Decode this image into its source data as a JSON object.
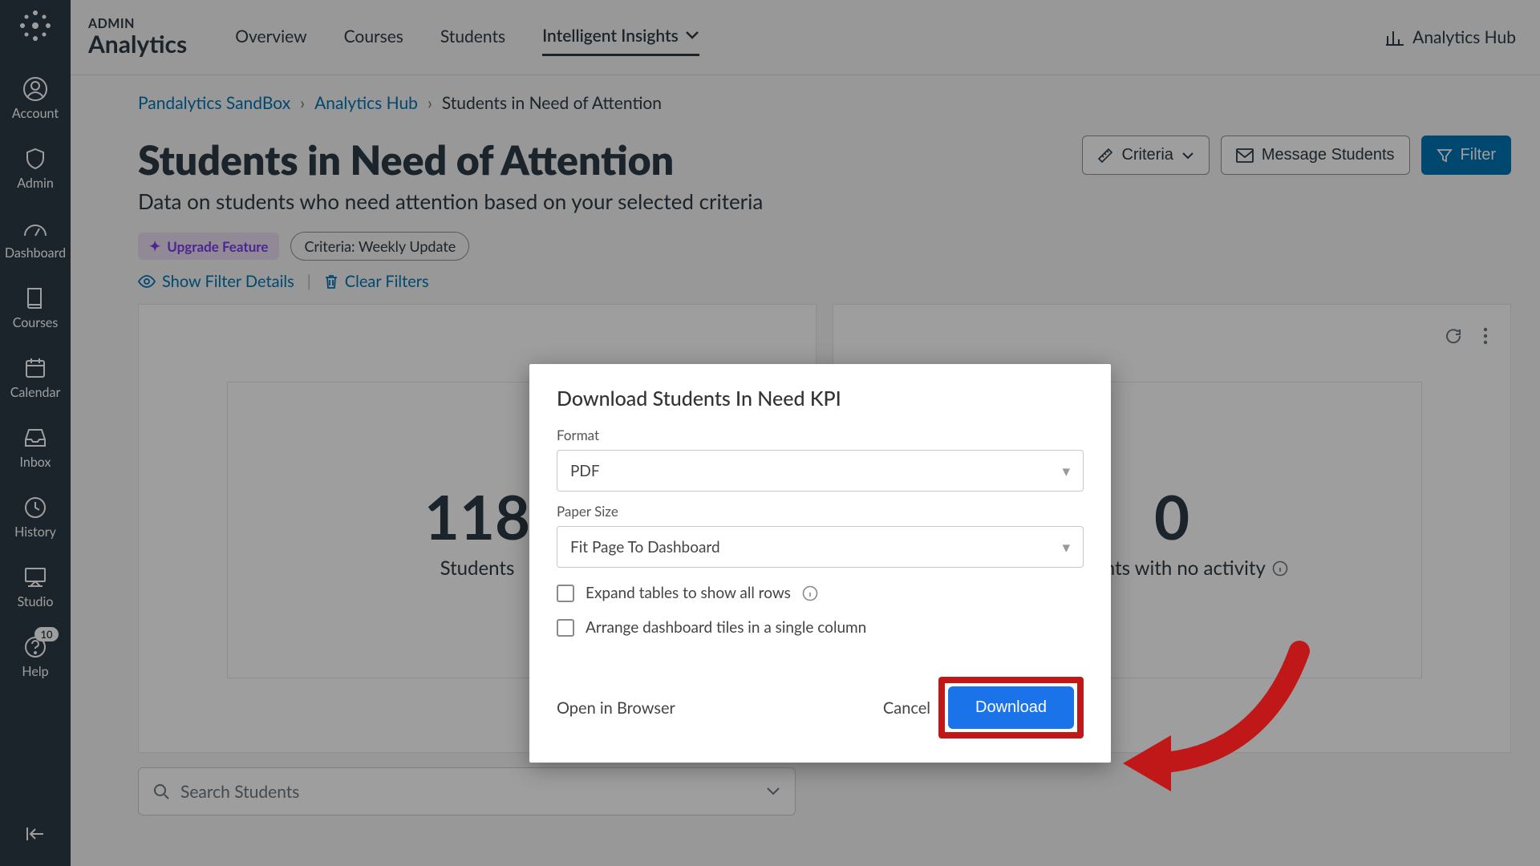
{
  "leftnav": {
    "items": [
      {
        "label": "Account"
      },
      {
        "label": "Admin"
      },
      {
        "label": "Dashboard"
      },
      {
        "label": "Courses"
      },
      {
        "label": "Calendar"
      },
      {
        "label": "Inbox"
      },
      {
        "label": "History"
      },
      {
        "label": "Studio"
      },
      {
        "label": "Help",
        "badge": "10"
      }
    ]
  },
  "topbar": {
    "sup": "ADMIN",
    "title": "Analytics",
    "tabs": [
      {
        "label": "Overview"
      },
      {
        "label": "Courses"
      },
      {
        "label": "Students"
      },
      {
        "label": "Intelligent Insights"
      }
    ],
    "hub": "Analytics Hub"
  },
  "crumbs": {
    "a": "Pandalytics SandBox",
    "b": "Analytics Hub",
    "c": "Students in Need of Attention"
  },
  "page": {
    "title": "Students in Need of Attention",
    "subtitle": "Data on students who need attention based on your selected criteria",
    "upgrade": "Upgrade Feature",
    "criteria_tag": "Criteria: Weekly Update",
    "show_filter": "Show Filter Details",
    "clear_filters": "Clear Filters"
  },
  "actions": {
    "criteria": "Criteria",
    "message": "Message Students",
    "filter": "Filter"
  },
  "cards": [
    {
      "value": "118",
      "label": "Students"
    },
    {
      "value": "0",
      "label": "Students with no activity"
    }
  ],
  "search": {
    "placeholder": "Search Students"
  },
  "modal": {
    "title": "Download Students In Need KPI",
    "format_label": "Format",
    "format_value": "PDF",
    "paper_label": "Paper Size",
    "paper_value": "Fit Page To Dashboard",
    "chk1": "Expand tables to show all rows",
    "chk2": "Arrange dashboard tiles in a single column",
    "open": "Open in Browser",
    "cancel": "Cancel",
    "download": "Download"
  }
}
